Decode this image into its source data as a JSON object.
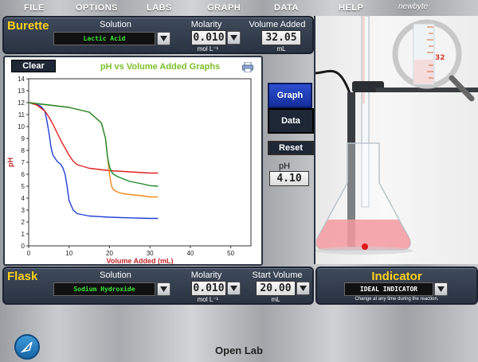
{
  "menu": [
    "FILE",
    "OPTIONS",
    "LABS",
    "GRAPH",
    "DATA",
    "HELP"
  ],
  "brand": "newbyte",
  "burette": {
    "title": "Burette",
    "solution_label": "Solution",
    "solution_value": "Lactic Acid",
    "molarity_label": "Molarity",
    "molarity_value": "0.010",
    "molarity_unit": "mol L⁻¹",
    "volume_label": "Volume Added",
    "volume_value": "32.05",
    "volume_unit": "mL"
  },
  "graph": {
    "clear_label": "Clear",
    "title": "pH vs Volume Added Graphs",
    "printer_icon": "printer-icon"
  },
  "controls": {
    "graph_label": "Graph",
    "data_label": "Data",
    "reset_label": "Reset",
    "ph_label": "pH",
    "ph_value": "4.10"
  },
  "zoom_reading": "32",
  "flask": {
    "title": "Flask",
    "solution_label": "Solution",
    "solution_value": "Sodium Hydroxide",
    "molarity_label": "Molarity",
    "molarity_value": "0.010",
    "molarity_unit": "mol L⁻¹",
    "start_volume_label": "Start Volume",
    "start_volume_value": "20.00",
    "start_volume_unit": "mL"
  },
  "indicator": {
    "title": "Indicator",
    "value": "IDEAL INDICATOR",
    "note": "Change at any time during the reaction."
  },
  "footer": {
    "title": "Open Lab"
  },
  "colors": {
    "accent_yellow": "#ffd21a",
    "panel": "#2f3a4a",
    "graph_title": "#7cbf2a",
    "axis_label": "#c0262c"
  },
  "chart_data": {
    "type": "line",
    "title": "pH vs Volume Added Graphs",
    "xlabel": "Volume Added (mL)",
    "ylabel": "pH",
    "xlim": [
      0,
      55
    ],
    "ylim": [
      0,
      14
    ],
    "xticks": [
      0,
      10,
      20,
      30,
      40,
      50
    ],
    "yticks": [
      0,
      1,
      2,
      3,
      4,
      5,
      6,
      7,
      8,
      9,
      10,
      11,
      12,
      13,
      14
    ],
    "grid": false,
    "series": [
      {
        "color": "#1f3fd6",
        "x": [
          0,
          1,
          2,
          3,
          4,
          4.5,
          5,
          5.5,
          6,
          7,
          8,
          8.5,
          9,
          9.5,
          10,
          11,
          12,
          15,
          20,
          25,
          30,
          32
        ],
        "y": [
          12,
          11.95,
          11.85,
          11.7,
          11.3,
          10.5,
          9.5,
          8.3,
          7.6,
          7.1,
          6.8,
          6.5,
          6.0,
          5.0,
          3.8,
          3.0,
          2.7,
          2.5,
          2.4,
          2.35,
          2.3,
          2.3
        ]
      },
      {
        "color": "#e0221f",
        "x": [
          0,
          2,
          4,
          5,
          6,
          7,
          8,
          9,
          10,
          11,
          12,
          15,
          20,
          25,
          30,
          32
        ],
        "y": [
          12,
          11.8,
          11.3,
          10.8,
          10.2,
          9.5,
          8.8,
          8.2,
          7.6,
          7.1,
          6.8,
          6.5,
          6.3,
          6.2,
          6.1,
          6.1
        ]
      },
      {
        "color": "#ef8a1a",
        "x": [
          0,
          5,
          10,
          15,
          18,
          19,
          19.5,
          20,
          20.5,
          21,
          22,
          23,
          25,
          28,
          30,
          32
        ],
        "y": [
          12,
          11.8,
          11.6,
          11.2,
          10.3,
          9.0,
          7.5,
          6.0,
          5.0,
          4.7,
          4.5,
          4.4,
          4.3,
          4.2,
          4.1,
          4.1
        ]
      },
      {
        "color": "#1e8a2a",
        "x": [
          0,
          5,
          10,
          15,
          18,
          19,
          19.5,
          20,
          20.5,
          21,
          22,
          25,
          28,
          30,
          32
        ],
        "y": [
          12,
          11.8,
          11.6,
          11.2,
          10.3,
          9.0,
          7.5,
          6.6,
          6.2,
          6.0,
          5.8,
          5.4,
          5.2,
          5.05,
          5.0
        ]
      }
    ]
  }
}
